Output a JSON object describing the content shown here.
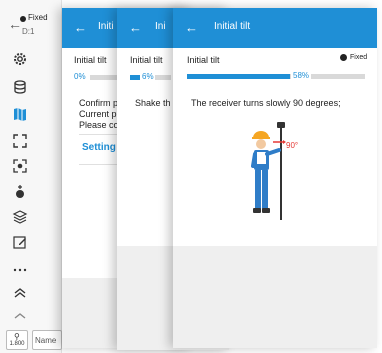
{
  "sidebar": {
    "status": "Fixed",
    "device": "D:1",
    "antenna_height": "1.800",
    "name_placeholder": "Name"
  },
  "card1": {
    "header_title": "Initi",
    "section": "Initial tilt",
    "progress_label": "0%",
    "progress": 0,
    "lines": [
      "Confirm p",
      "Current p",
      "Please co"
    ],
    "link": "Setting"
  },
  "card2": {
    "header_title": "Ini",
    "section": "Initial tilt",
    "progress_label": "6%",
    "progress": 0.06,
    "message": "Shake th"
  },
  "card3": {
    "header_title": "Initial tilt",
    "section": "Initial tilt",
    "status": "Fixed",
    "progress_label": "58%",
    "progress": 0.58,
    "message": "The receiver turns slowly 90 degrees;",
    "angle_label": "90°"
  },
  "colors": {
    "header": "#1f8fd6",
    "progress": "#1f8fd6",
    "angle": "#e53935"
  }
}
